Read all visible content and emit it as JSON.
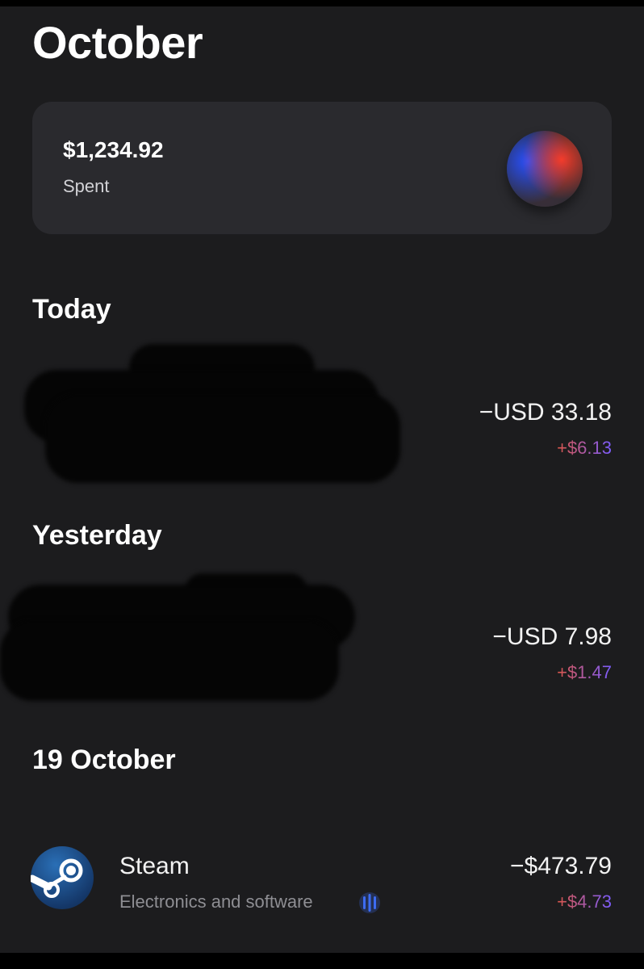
{
  "header": {
    "title": "October"
  },
  "summary": {
    "amount": "$1,234.92",
    "label": "Spent",
    "orb_icon": "gradient-orb-icon"
  },
  "sections": [
    {
      "heading": "Today",
      "transactions": [
        {
          "merchant": "",
          "redacted": true,
          "amount": "−USD 33.18",
          "cashback": "+$6.13"
        }
      ]
    },
    {
      "heading": "Yesterday",
      "transactions": [
        {
          "merchant": "",
          "redacted": true,
          "amount": "−USD 7.98",
          "cashback": "+$1.47"
        }
      ]
    },
    {
      "heading": "19 October",
      "transactions": [
        {
          "merchant": "Steam",
          "category": "Electronics and software",
          "icon": "steam-logo-icon",
          "category_icon": "processing-bars-icon",
          "amount": "−$473.79",
          "cashback": "+$4.73"
        }
      ]
    }
  ],
  "colors": {
    "background": "#1c1c1e",
    "card": "#2a2a2e",
    "cashback_start": "#e0574a",
    "cashback_end": "#7b5cff",
    "secondary_text": "#8e8e93",
    "category_icon": "#3d6cf2"
  }
}
